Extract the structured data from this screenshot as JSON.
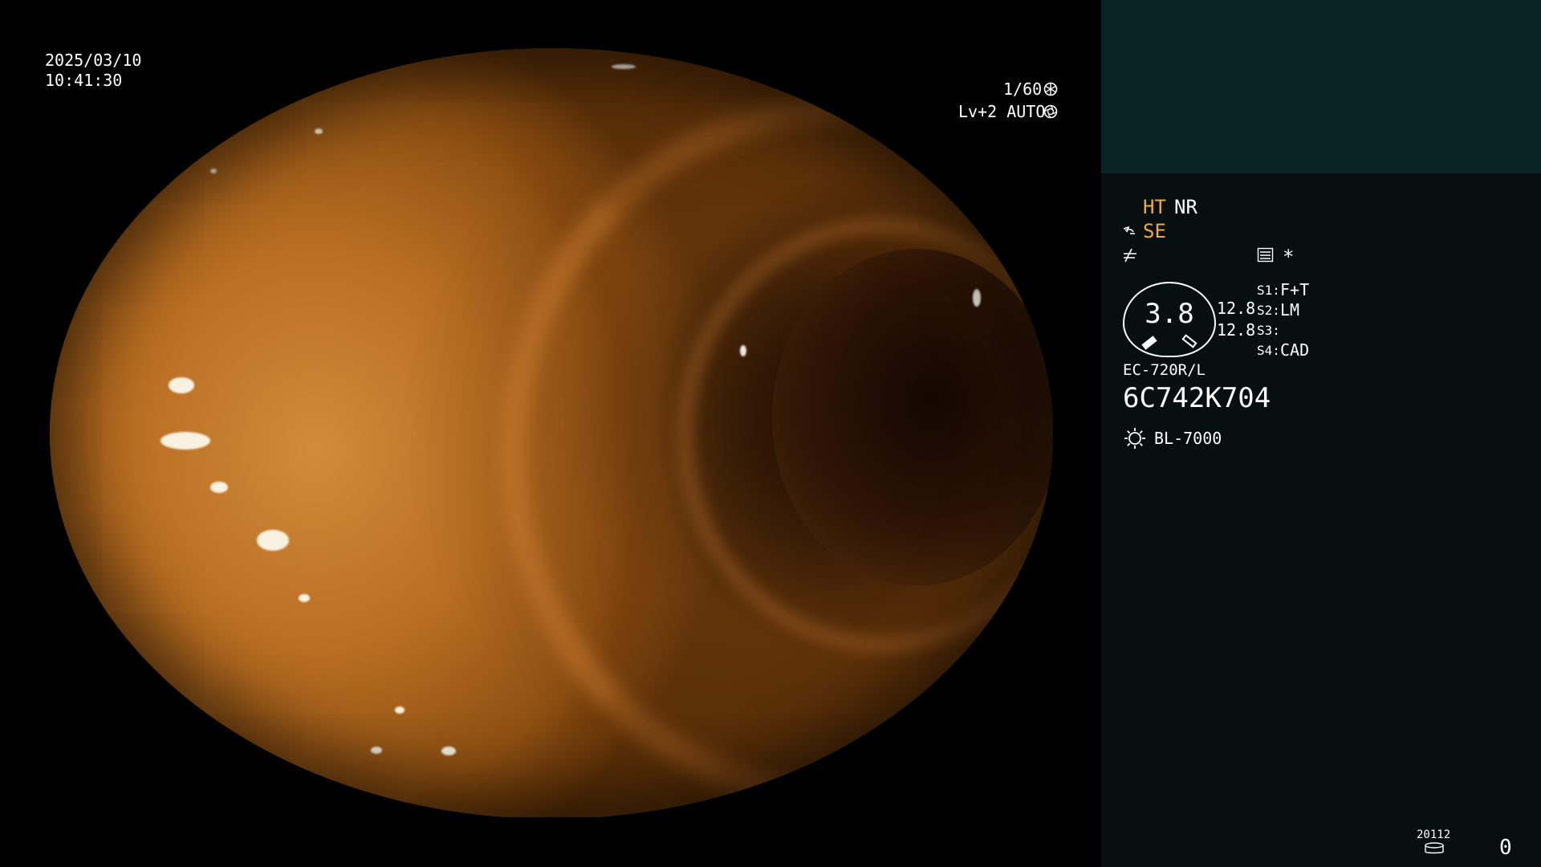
{
  "osd": {
    "date": "2025/03/10",
    "time": "10:41:30",
    "shutter": "1/60",
    "shutter_icon": "aperture-icon",
    "level": "Lv+2 AUTO",
    "auto_icon": "iris-icon"
  },
  "panel": {
    "mode_ht": "HT",
    "mode_nr": "NR",
    "mode_se": "SE",
    "enhance_icon": "structure-enhance-icon",
    "color_icon": "color-tone-icon",
    "menu_icon": "settings-list-icon",
    "asterisk": "*",
    "gauge_value": "3.8",
    "gauge_sub_1": "12.8",
    "gauge_sub_2": "12.8",
    "switches": [
      {
        "key": "S1:",
        "value": "F+T"
      },
      {
        "key": "S2:",
        "value": "LM"
      },
      {
        "key": "S3:",
        "value": ""
      },
      {
        "key": "S4:",
        "value": "CAD"
      }
    ],
    "scope_model": "EC-720R/L",
    "scope_serial": "6C742K704",
    "light_icon": "light-source-icon",
    "light_source": "BL-7000",
    "counter_label": "20112",
    "counter_icon": "storage-icon",
    "counter_value": "0"
  },
  "colors": {
    "accent": "#f0a93a",
    "panel_bg": "#070f10",
    "panel_top_bg": "#0a2426"
  }
}
